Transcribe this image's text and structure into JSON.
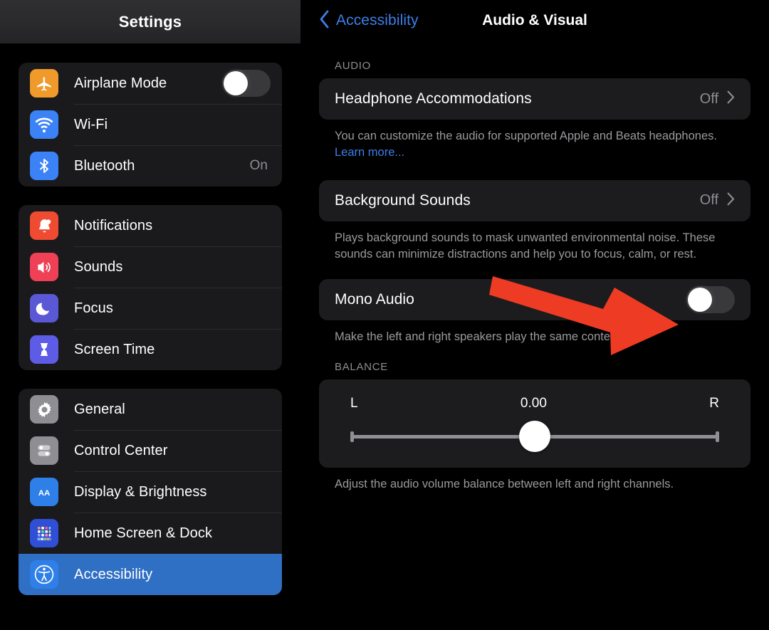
{
  "sidebar": {
    "header_title": "Settings",
    "groups": [
      {
        "rows": [
          {
            "label": "Airplane Mode",
            "icon": "airplane-icon",
            "icon_color": "#ef9a2b",
            "control": "toggle",
            "toggle_on": false,
            "value": ""
          },
          {
            "label": "Wi-Fi",
            "icon": "wifi-icon",
            "icon_color": "#3b82f6",
            "control": "value",
            "value": ""
          },
          {
            "label": "Bluetooth",
            "icon": "bluetooth-icon",
            "icon_color": "#3b82f6",
            "control": "value",
            "value": "On"
          }
        ]
      },
      {
        "rows": [
          {
            "label": "Notifications",
            "icon": "bell-icon",
            "icon_color": "#ef4b33",
            "control": "none",
            "value": ""
          },
          {
            "label": "Sounds",
            "icon": "speaker-icon",
            "icon_color": "#ef4056",
            "control": "none",
            "value": ""
          },
          {
            "label": "Focus",
            "icon": "moon-icon",
            "icon_color": "#5b58d6",
            "control": "none",
            "value": ""
          },
          {
            "label": "Screen Time",
            "icon": "hourglass-icon",
            "icon_color": "#5d5ce6",
            "control": "none",
            "value": ""
          }
        ]
      },
      {
        "rows": [
          {
            "label": "General",
            "icon": "gear-icon",
            "icon_color": "#8e8e93",
            "control": "none",
            "value": ""
          },
          {
            "label": "Control Center",
            "icon": "control-center-icon",
            "icon_color": "#8e8e93",
            "control": "none",
            "value": ""
          },
          {
            "label": "Display & Brightness",
            "icon": "display-brightness-icon",
            "icon_color": "#2f7fe8",
            "control": "none",
            "value": ""
          },
          {
            "label": "Home Screen & Dock",
            "icon": "home-screen-icon",
            "icon_color": "#2f4fd6",
            "control": "none",
            "value": ""
          },
          {
            "label": "Accessibility",
            "icon": "accessibility-icon",
            "icon_color": "#2f7fe8",
            "control": "none",
            "value": "",
            "selected": true
          }
        ]
      }
    ],
    "selected_highlight_color": "#2f6fc4"
  },
  "detail": {
    "back_label": "Accessibility",
    "title": "Audio & Visual",
    "accent_color": "#3d7fe8",
    "sections": [
      {
        "header": "AUDIO",
        "rows": [
          {
            "label": "Headphone Accommodations",
            "value": "Off",
            "control": "chevron"
          }
        ],
        "footnote": "You can customize the audio for supported Apple and Beats headphones. ",
        "footnote_link": "Learn more..."
      },
      {
        "header": "",
        "rows": [
          {
            "label": "Background Sounds",
            "value": "Off",
            "control": "chevron"
          }
        ],
        "footnote": "Plays background sounds to mask unwanted environmental noise. These sounds can minimize distractions and help you to focus, calm, or rest.",
        "footnote_link": ""
      },
      {
        "header": "",
        "rows": [
          {
            "label": "Mono Audio",
            "value": "",
            "control": "toggle",
            "toggle_on": false
          }
        ],
        "footnote": "Make the left and right speakers play the same content.",
        "footnote_link": ""
      }
    ],
    "balance": {
      "header": "BALANCE",
      "left_label": "L",
      "right_label": "R",
      "value": "0.00",
      "position_percent": 50,
      "footnote": "Adjust the audio volume balance between left and right channels."
    }
  },
  "annotation": {
    "arrow_color": "#ee3b24",
    "points_to": "mono-audio-toggle"
  }
}
